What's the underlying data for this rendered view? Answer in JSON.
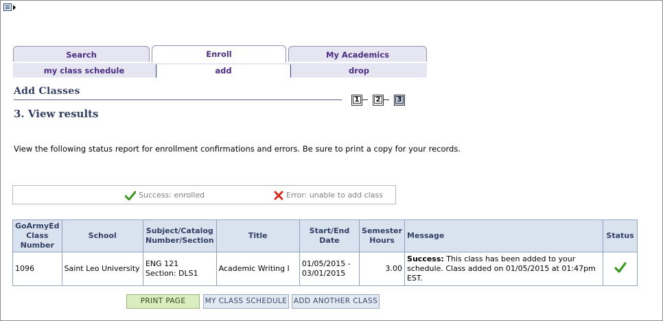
{
  "tabs": [
    {
      "label": "Search"
    },
    {
      "label": "Enroll",
      "active": true
    },
    {
      "label": "My Academics"
    }
  ],
  "subtabs": [
    {
      "label": "my class schedule"
    },
    {
      "label": "add",
      "active": true
    },
    {
      "label": "drop"
    }
  ],
  "page": {
    "title": "Add Classes",
    "step_title": "3. View results",
    "instructions": "View the following status report for enrollment confirmations and errors.  Be sure to print a copy for your records.",
    "steps": [
      "1",
      "2",
      "3"
    ],
    "current_step": 3
  },
  "legend": {
    "success": "Success: enrolled",
    "error": "Error: unable to add class"
  },
  "table": {
    "headers": {
      "class_number": [
        "GoArmyEd",
        "Class",
        "Number"
      ],
      "school": "School",
      "subject": [
        "Subject/Catalog",
        "Number/Section"
      ],
      "title": "Title",
      "dates": [
        "Start/End",
        "Date"
      ],
      "hours": [
        "Semester",
        "Hours"
      ],
      "message": "Message",
      "status": "Status"
    },
    "rows": [
      {
        "class_number": "1096",
        "school": "Saint Leo University",
        "subject": "ENG 121",
        "section": "Section: DLS1",
        "title": "Academic Writing I",
        "start_date": "01/05/2015 -",
        "end_date": "03/01/2015",
        "hours": "3.00",
        "message_label": "Success:",
        "message_text": " This class has been added to your schedule. Class added on 01/05/2015 at 01:47pm EST.",
        "status_icon": "checkmark-icon"
      }
    ]
  },
  "buttons": {
    "print": "PRINT PAGE",
    "schedule": "MY CLASS SCHEDULE",
    "add_another": "ADD ANOTHER CLASS"
  },
  "colors": {
    "tab_text": "#4b2c83",
    "heading": "#323e63",
    "success_green": "#3a9a20",
    "error_red": "#d42a1a"
  }
}
